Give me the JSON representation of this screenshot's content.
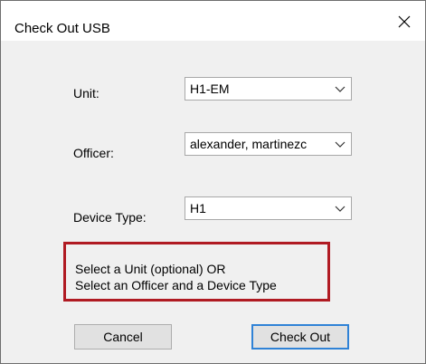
{
  "window": {
    "title": "Check Out USB",
    "close_icon": "close-icon"
  },
  "form": {
    "unit_label": "Unit:",
    "unit_value": "H1-EM",
    "officer_label": "Officer:",
    "officer_value": "alexander, martinezc",
    "device_type_label": "Device Type:",
    "device_type_value": "H1",
    "dropdown_icon": "chevron-down-icon"
  },
  "notice": {
    "line1": "Select a Unit (optional) OR",
    "line2": "Select an Officer and a Device Type",
    "border_color": "#b01a22"
  },
  "buttons": {
    "cancel": "Cancel",
    "check_out": "Check Out",
    "default_accent": "#2f82d6"
  }
}
